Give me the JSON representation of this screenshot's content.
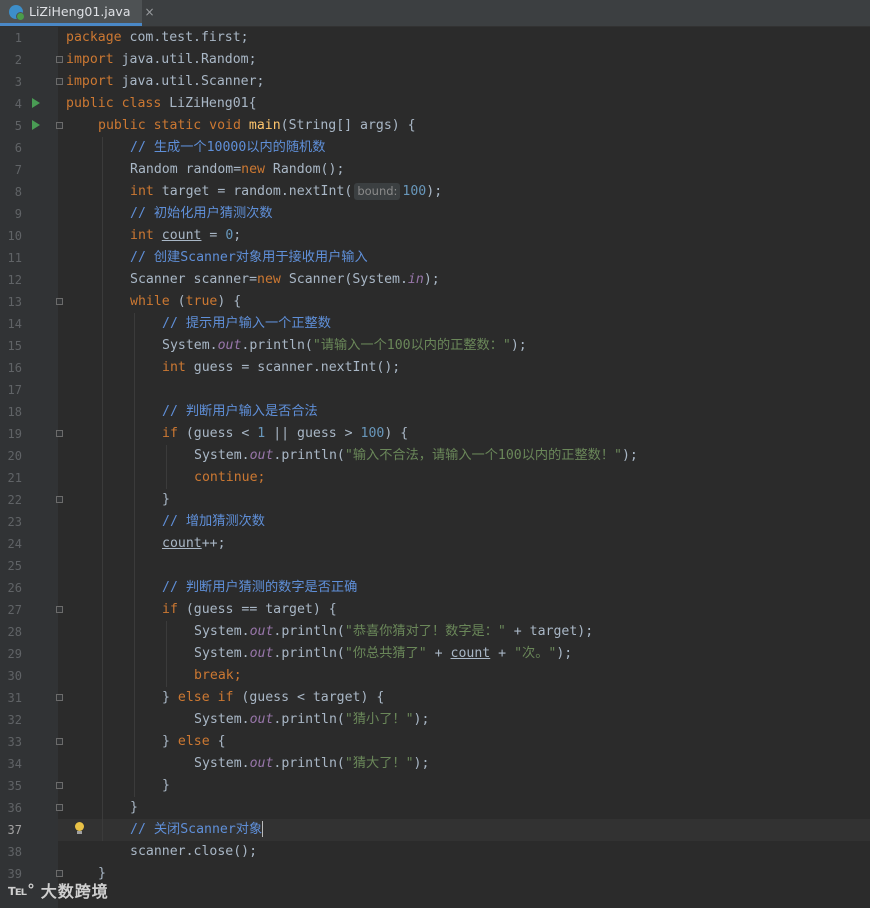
{
  "tab": {
    "label": "LiZiHeng01.java",
    "close": "×",
    "icon": "java-class-icon"
  },
  "current_line": 37,
  "lines": [
    "1",
    "2",
    "3",
    "4",
    "5",
    "6",
    "7",
    "8",
    "9",
    "10",
    "11",
    "12",
    "13",
    "14",
    "15",
    "16",
    "17",
    "18",
    "19",
    "20",
    "21",
    "22",
    "23",
    "24",
    "25",
    "26",
    "27",
    "28",
    "29",
    "30",
    "31",
    "32",
    "33",
    "34",
    "35",
    "36",
    "37",
    "38",
    "39"
  ],
  "code": {
    "l1_kw": "package",
    "l1_rest": " com.test.first;",
    "l2_kw": "import",
    "l2_rest": " java.util.Random;",
    "l3_kw": "import",
    "l3_rest": " java.util.Scanner;",
    "l4_kw": "public class",
    "l4_rest": " LiZiHeng01{",
    "l5_kw": "public static void",
    "l5_fn": "main",
    "l5_rest": "(String[] args) {",
    "l6": "// 生成一个10000以内的随机数",
    "l7_a": "Random random=",
    "l7_kw": "new",
    "l7_b": " Random();",
    "l8_kw": "int",
    "l8_a": " target = random.nextInt(",
    "l8_hint": "bound:",
    "l8_num": "100",
    "l8_b": ");",
    "l9": "// 初始化用户猜测次数",
    "l10_kw": "int",
    "l10_var": "count",
    "l10_a": " = ",
    "l10_num": "0",
    "l10_b": ";",
    "l11": "// 创建Scanner对象用于接收用户输入",
    "l12_a": "Scanner scanner=",
    "l12_kw": "new",
    "l12_b": " Scanner(System.",
    "l12_sf": "in",
    "l12_c": ");",
    "l13_kw": "while",
    "l13_a": " (",
    "l13_kw2": "true",
    "l13_b": ") {",
    "l14": "// 提示用户输入一个正整数",
    "l15_a": "System.",
    "l15_sf": "out",
    "l15_b": ".println(",
    "l15_st": "\"请输入一个100以内的正整数：\"",
    "l15_c": ");",
    "l16_kw": "int",
    "l16_a": " guess = scanner.nextInt();",
    "l18": "// 判断用户输入是否合法",
    "l19_kw": "if",
    "l19_a": " (guess < ",
    "l19_n1": "1",
    "l19_b": " || guess > ",
    "l19_n2": "100",
    "l19_c": ") {",
    "l20_a": "System.",
    "l20_sf": "out",
    "l20_b": ".println(",
    "l20_st": "\"输入不合法，请输入一个100以内的正整数！\"",
    "l20_c": ");",
    "l21_kw": "continue",
    "l21_b": ";",
    "l22": "}",
    "l23": "// 增加猜测次数",
    "l24_var": "count",
    "l24_b": "++;",
    "l26": "// 判断用户猜测的数字是否正确",
    "l27_kw": "if",
    "l27_a": " (guess == target) {",
    "l28_a": "System.",
    "l28_sf": "out",
    "l28_b": ".println(",
    "l28_st": "\"恭喜你猜对了！数字是：\"",
    "l28_c": " + target);",
    "l29_a": "System.",
    "l29_sf": "out",
    "l29_b": ".println(",
    "l29_st": "\"你总共猜了\"",
    "l29_c": " + ",
    "l29_var": "count",
    "l29_d": " + ",
    "l29_st2": "\"次。\"",
    "l29_e": ");",
    "l30_kw": "break",
    "l30_b": ";",
    "l31_a": "} ",
    "l31_kw": "else if",
    "l31_b": " (guess < target) {",
    "l32_a": "System.",
    "l32_sf": "out",
    "l32_b": ".println(",
    "l32_st": "\"猜小了！\"",
    "l32_c": ");",
    "l33_a": "} ",
    "l33_kw": "else",
    "l33_b": " {",
    "l34_a": "System.",
    "l34_sf": "out",
    "l34_b": ".println(",
    "l34_st": "\"猜大了！\"",
    "l34_c": ");",
    "l35": "}",
    "l36": "}",
    "l37": "// 关闭Scanner对象",
    "l38": "scanner.close();",
    "l39": "}"
  },
  "watermark": {
    "logo": "℡°",
    "text": "大数跨境"
  },
  "colors": {
    "keyword": "#cc7832",
    "comment": "#5f8fd8",
    "string": "#6a8759",
    "number": "#6897bb",
    "method": "#ffc66d",
    "static_field": "#9876aa",
    "background": "#2b2b2b"
  }
}
